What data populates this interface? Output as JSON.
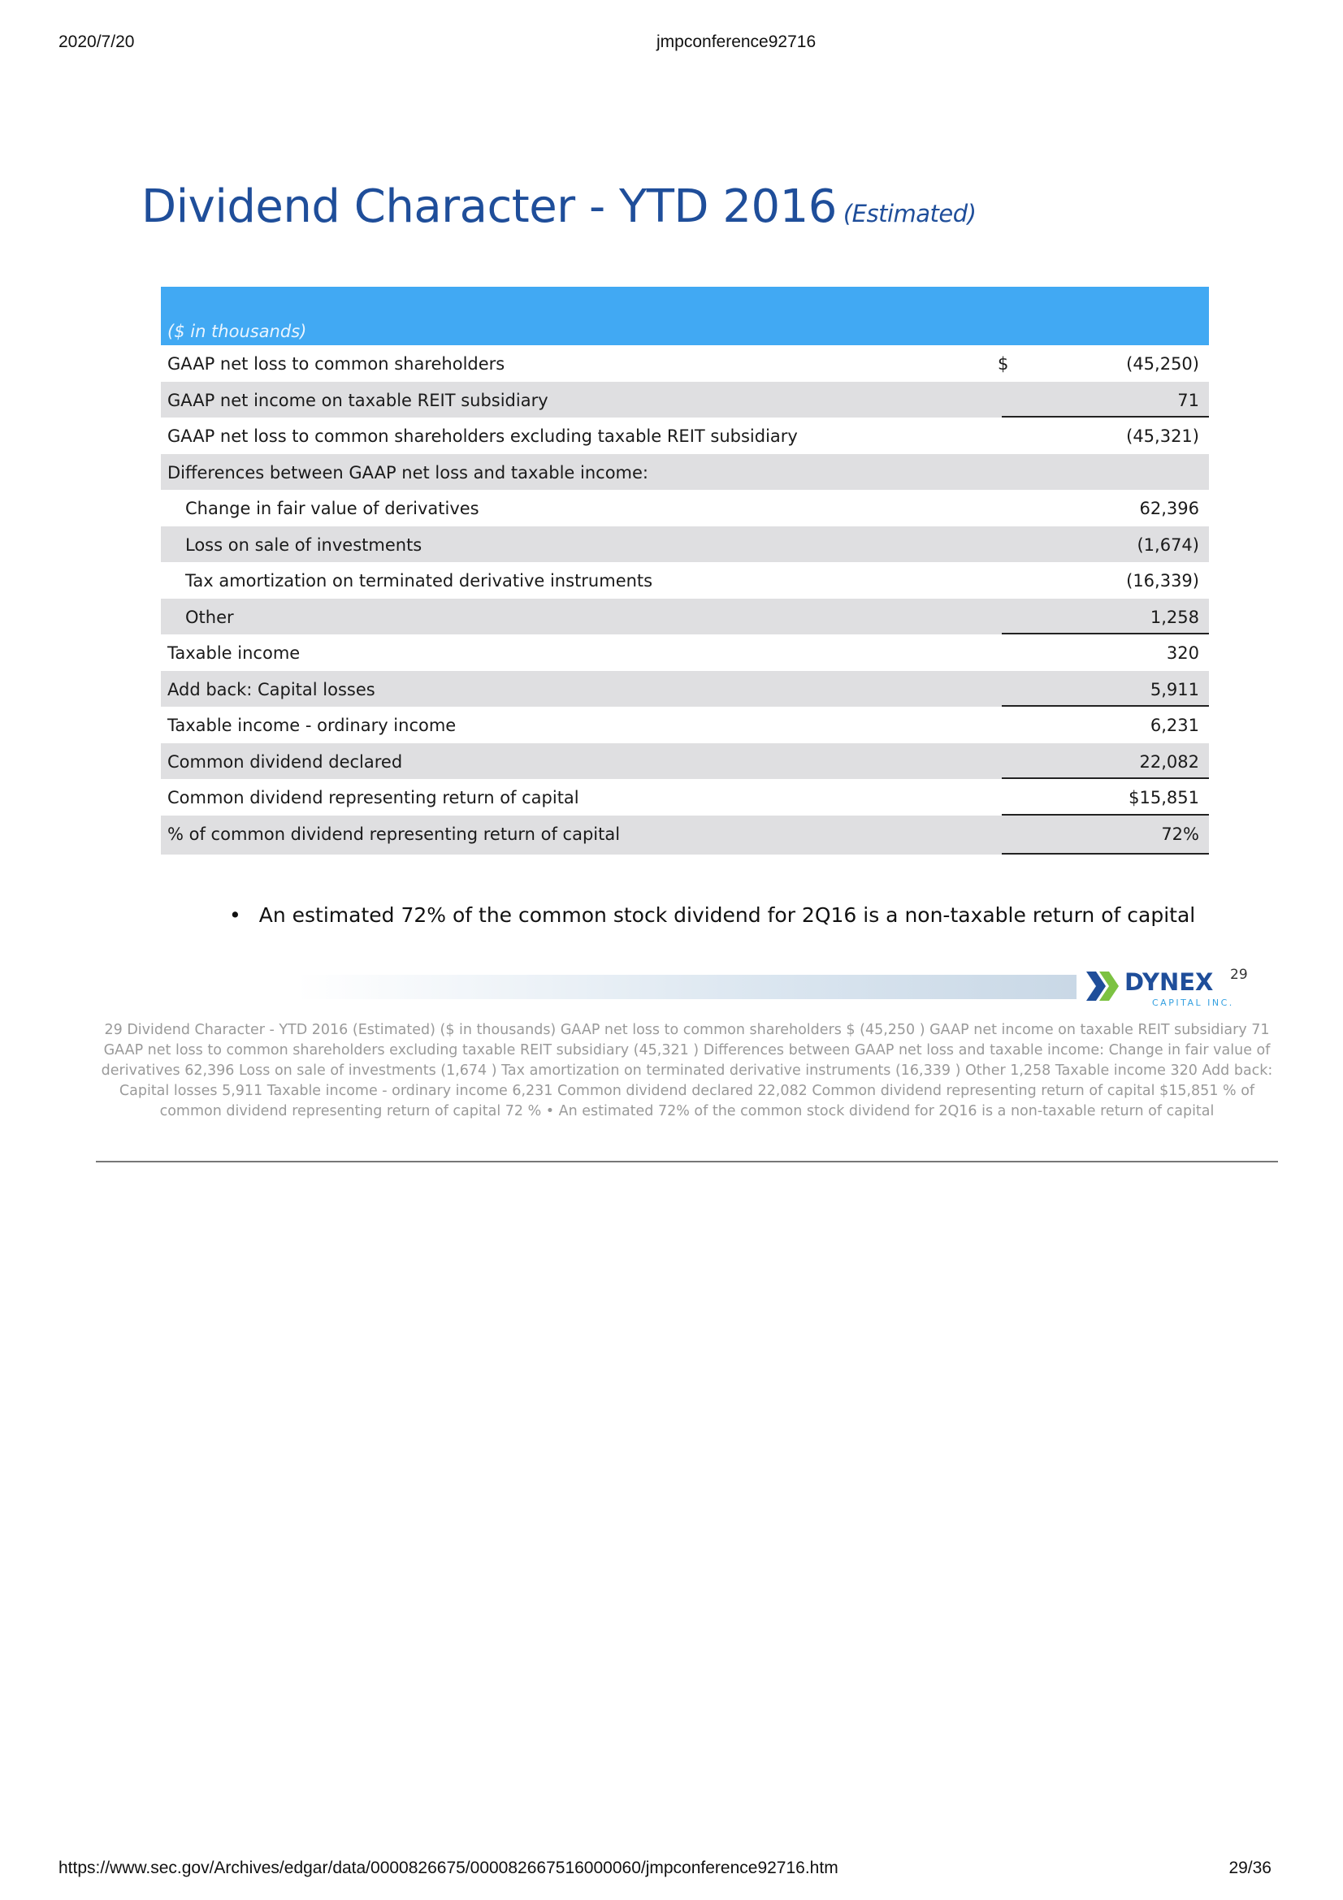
{
  "browser": {
    "date": "2020/7/20",
    "doc_title": "jmpconference92716",
    "url": "https://www.sec.gov/Archives/edgar/data/0000826675/000082667516000060/jmpconference92716.htm",
    "page": "29/36"
  },
  "slide": {
    "title": "Dividend Character - YTD 2016",
    "subtitle": "(Estimated)",
    "table_header": "($ in thousands)",
    "rows": [
      {
        "label": "GAAP net loss to common shareholders",
        "currency": "$",
        "value": "(45,250)"
      },
      {
        "label": "GAAP net income on taxable REIT subsidiary",
        "value": "71"
      },
      {
        "label": "GAAP net loss to common shareholders excluding taxable REIT subsidiary",
        "value": "(45,321)"
      },
      {
        "label": "Differences between GAAP net loss and taxable income:",
        "value": ""
      },
      {
        "label": "Change in fair value of derivatives",
        "value": "62,396"
      },
      {
        "label": "Loss on sale of investments",
        "value": "(1,674)"
      },
      {
        "label": "Tax amortization on terminated derivative instruments",
        "value": "(16,339)"
      },
      {
        "label": "Other",
        "value": "1,258"
      },
      {
        "label": "Taxable income",
        "value": "320"
      },
      {
        "label": "Add back: Capital losses",
        "value": "5,911"
      },
      {
        "label": "Taxable income - ordinary income",
        "value": "6,231"
      },
      {
        "label": "Common dividend declared",
        "value": "22,082"
      },
      {
        "label": "Common dividend representing return of capital",
        "value": "$15,851"
      },
      {
        "label": "% of common dividend representing return of capital",
        "value": "72%"
      }
    ],
    "bullet": "An estimated 72% of the common stock dividend for 2Q16 is a non-taxable return of capital",
    "logo_name": "DYNEX",
    "logo_sub": "CAPITAL INC.",
    "slide_number": "29"
  },
  "alt_text": "29  Dividend Character - YTD 2016 (Estimated)  ($ in thousands)  GAAP net loss to common shareholders $ (45,250 )  GAAP net income on taxable REIT subsidiary 71  GAAP net loss to common shareholders excluding taxable REIT subsidiary (45,321 )  Differences between GAAP net loss and taxable income:  Change in fair value of derivatives 62,396  Loss on sale of investments (1,674 )  Tax amortization on terminated derivative instruments (16,339 )  Other 1,258  Taxable income 320  Add back: Capital losses 5,911  Taxable income - ordinary income 6,231  Common dividend declared 22,082  Common dividend representing return of capital $15,851  % of common dividend representing return of capital 72 %  • An estimated 72% of the common stock dividend for 2Q16 is a non-taxable return of capital"
}
